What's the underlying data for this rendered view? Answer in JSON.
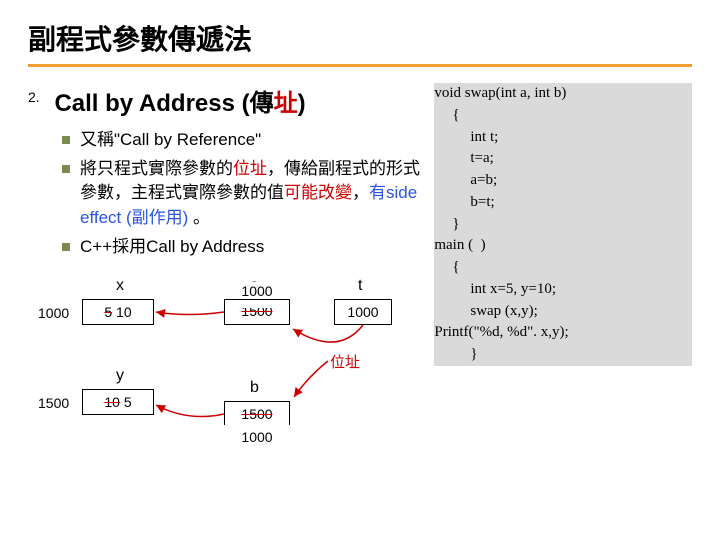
{
  "title": "副程式參數傳遞法",
  "section": {
    "number": "2.",
    "heading_pre": "Call by Address (傳",
    "heading_red": "址",
    "heading_post": ")"
  },
  "bullets": [
    {
      "pre": "又稱\"Call by Reference\""
    },
    {
      "pre": "將只程式實際參數的",
      "red1": "位址",
      "mid": "，傳給副程式的形式參數，主程式實際參數的值",
      "red2": "可能改變",
      "mid2": "，",
      "blue": "有side effect (副作用)",
      "post": " 。"
    },
    {
      "pre": "C++採用Call by Address"
    }
  ],
  "diagram": {
    "x": {
      "label": "x",
      "addr": "1000",
      "old": "5",
      "new": "10"
    },
    "y": {
      "label": "y",
      "addr": "1500",
      "old": "10",
      "new": "5"
    },
    "a": {
      "label": "a",
      "old": "1500",
      "new": "1000"
    },
    "b": {
      "label": "b",
      "old": "1500",
      "new": "1000"
    },
    "t": {
      "label": "t",
      "val": "1000"
    },
    "addr_label": "位址"
  },
  "code": {
    "l1": "void swap(int a, int b)",
    "l2": "{",
    "l3": "int t;",
    "l4": "t=a;",
    "l5": "a=b;",
    "l6": "b=t;",
    "l7": "}",
    "l8": "main (  )",
    "l9": "{",
    "l10": "int x=5, y=10;",
    "l11": "swap (x,y);",
    "l12": "Printf(\"%d, %d\". x,y);",
    "l13": "}"
  }
}
